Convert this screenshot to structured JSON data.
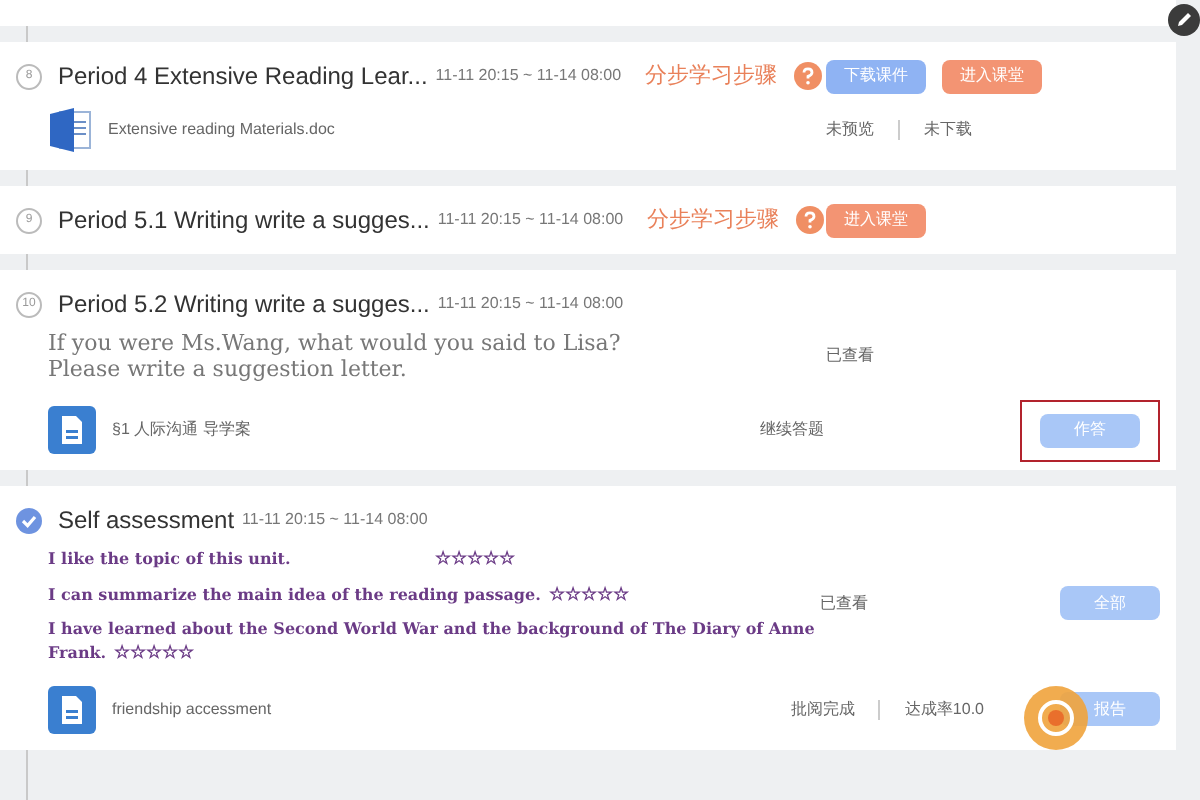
{
  "tasks": [
    {
      "kind": "period",
      "step": "8",
      "done": false,
      "title": "Period 4 Extensive Reading Lear...",
      "time": "11-11 20:15 ~ 11-14 08:00",
      "steps_link": "分步学习步骤",
      "buttons": [
        {
          "label": "下载课件",
          "kind": "download"
        },
        {
          "label": "进入课堂",
          "kind": "enter"
        }
      ],
      "file": {
        "kind": "word",
        "name": "Extensive reading Materials.doc"
      },
      "status": [
        "未预览",
        "未下载"
      ]
    },
    {
      "kind": "period",
      "step": "9",
      "done": false,
      "title": "Period 5.1 Writing write a sugges...",
      "time": "11-11 20:15 ~ 11-14 08:00",
      "steps_link": "分步学习步骤",
      "buttons": [
        {
          "label": "进入课堂",
          "kind": "enter"
        }
      ]
    },
    {
      "kind": "homework",
      "step": "10",
      "done": false,
      "title": "Period 5.2 Writing write a sugges...",
      "time": "11-11 20:15 ~ 11-14 08:00",
      "prompt": [
        "If you were Ms.Wang, what would you said to Lisa?",
        "Please write a suggestion letter."
      ],
      "top_status": "已查看",
      "file": {
        "kind": "doc",
        "name": "§1 人际沟通 导学案"
      },
      "status": [
        "继续答题"
      ],
      "action": {
        "label": "作答",
        "highlighted": true
      }
    },
    {
      "kind": "assessment",
      "done": true,
      "title": "Self assessment",
      "time": "11-11 20:15 ~ 11-14 08:00",
      "lines": [
        {
          "text": "I like the topic of this unit.",
          "stars": "☆☆☆☆☆"
        },
        {
          "text": "I can summarize the main idea of the reading passage.",
          "stars": "☆☆☆☆☆"
        },
        {
          "text": "I have learned about the Second World War and the background of The Diary of Anne Frank.",
          "stars": "☆☆☆☆☆"
        }
      ],
      "top_status": "已查看",
      "top_button": "全部",
      "file": {
        "kind": "doc",
        "name": "friendship accessment"
      },
      "status": [
        "批阅完成",
        "达成率10.0"
      ],
      "action": {
        "label": "报告",
        "highlighted": false
      }
    }
  ]
}
